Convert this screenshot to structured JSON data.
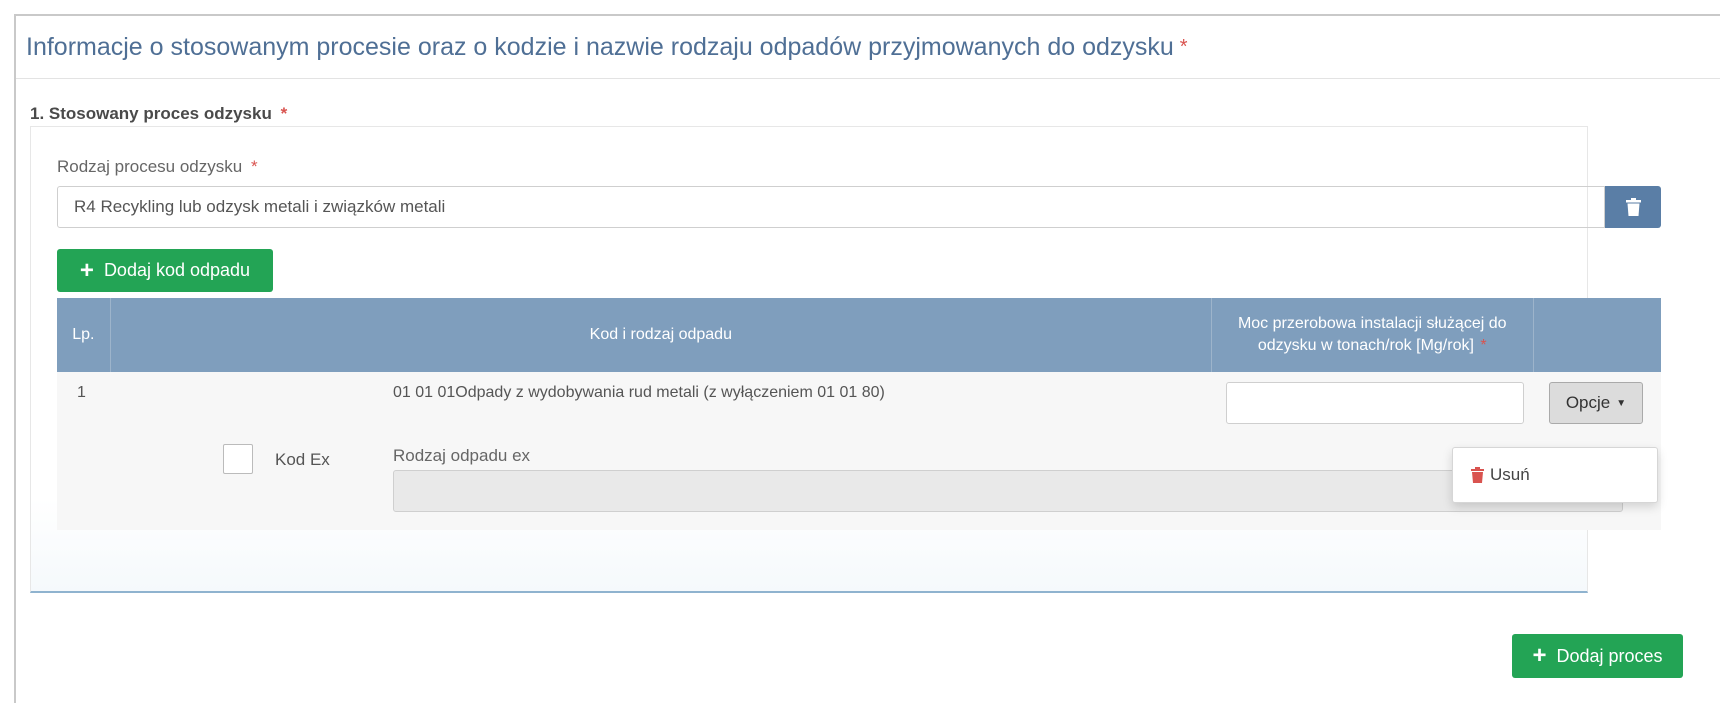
{
  "panel": {
    "title": "Informacje o stosowanym procesie oraz o kodzie i nazwie rodzaju odpadów przyjmowanych do odzysku",
    "required_mark": "*"
  },
  "section": {
    "title": "1. Stosowany proces odzysku",
    "required_mark": "*"
  },
  "process": {
    "label": "Rodzaj procesu odzysku",
    "required_mark": "*",
    "value": "R4 Recykling lub odzysk metali i związków metali",
    "delete_icon": "trash-icon"
  },
  "add_code_button": {
    "icon": "plus-icon",
    "label": "Dodaj kod odpadu"
  },
  "table": {
    "headers": {
      "lp": "Lp.",
      "code": "Kod i rodzaj odpadu",
      "capacity": "Moc przerobowa instalacji służącej do odzysku w tonach/rok [Mg/rok]",
      "capacity_required": "*"
    },
    "rows": [
      {
        "lp": "1",
        "code": "01 01 01Odpady z wydobywania rud metali (z wyłączeniem 01 01 80)",
        "capacity_value": "",
        "options_label": "Opcje",
        "kod_ex_label": "Kod Ex",
        "kod_ex_checked": false,
        "ex_label": "Rodzaj odpadu ex",
        "ex_value": ""
      }
    ]
  },
  "dropdown": {
    "items": [
      {
        "icon": "trash-icon",
        "label": "Usuń",
        "color": "#d9534f"
      }
    ]
  },
  "add_process_button": {
    "icon": "plus-icon",
    "label": "Dodaj proces"
  },
  "colors": {
    "heading": "#4f6f95",
    "required": "#d9534f",
    "table_header": "#7f9ebd",
    "delete_button": "#5a7ea6",
    "green_button": "#23a455"
  }
}
